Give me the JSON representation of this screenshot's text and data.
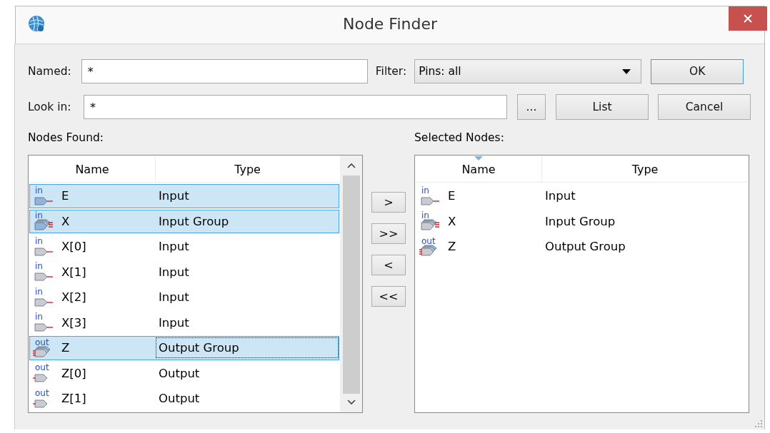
{
  "window": {
    "title": "Node Finder"
  },
  "named": {
    "label": "Named:",
    "value": "*"
  },
  "filter": {
    "label": "Filter:",
    "value": "Pins: all"
  },
  "look_in": {
    "label": "Look in:",
    "value": "*"
  },
  "buttons": {
    "ok": "OK",
    "cancel": "Cancel",
    "list": "List",
    "browse": "..."
  },
  "nodes_found": {
    "label": "Nodes Found:",
    "columns": [
      {
        "label": "Name",
        "sorted": false
      },
      {
        "label": "Type",
        "sorted": false
      }
    ],
    "rows": [
      {
        "kind": "input",
        "tag": "in",
        "name": "E",
        "type": "Input",
        "selected": true,
        "focused": false
      },
      {
        "kind": "input-group",
        "tag": "in",
        "name": "X",
        "type": "Input Group",
        "selected": true,
        "focused": false
      },
      {
        "kind": "input",
        "tag": "in",
        "name": "X[0]",
        "type": "Input",
        "selected": false,
        "focused": false
      },
      {
        "kind": "input",
        "tag": "in",
        "name": "X[1]",
        "type": "Input",
        "selected": false,
        "focused": false
      },
      {
        "kind": "input",
        "tag": "in",
        "name": "X[2]",
        "type": "Input",
        "selected": false,
        "focused": false
      },
      {
        "kind": "input",
        "tag": "in",
        "name": "X[3]",
        "type": "Input",
        "selected": false,
        "focused": false
      },
      {
        "kind": "output-group",
        "tag": "out",
        "name": "Z",
        "type": "Output Group",
        "selected": true,
        "focused": true
      },
      {
        "kind": "output",
        "tag": "out",
        "name": "Z[0]",
        "type": "Output",
        "selected": false,
        "focused": false
      },
      {
        "kind": "output",
        "tag": "out",
        "name": "Z[1]",
        "type": "Output",
        "selected": false,
        "focused": false
      }
    ]
  },
  "move_buttons": [
    ">",
    ">>",
    "<",
    "<<"
  ],
  "selected_nodes": {
    "label": "Selected Nodes:",
    "columns": [
      {
        "label": "Name",
        "sorted": true
      },
      {
        "label": "Type",
        "sorted": false
      }
    ],
    "rows": [
      {
        "kind": "input",
        "tag": "in",
        "name": "E",
        "type": "Input",
        "selected": false,
        "focused": false
      },
      {
        "kind": "input-group",
        "tag": "in",
        "name": "X",
        "type": "Input Group",
        "selected": false,
        "focused": false
      },
      {
        "kind": "output-group",
        "tag": "out",
        "name": "Z",
        "type": "Output Group",
        "selected": false,
        "focused": false
      }
    ]
  }
}
